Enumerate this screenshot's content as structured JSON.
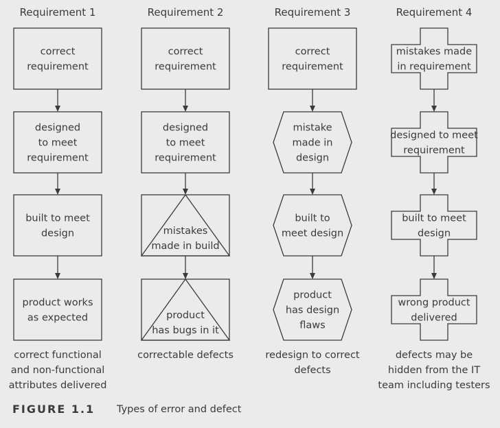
{
  "figure": {
    "label": "FIGURE 1.1",
    "caption": "Types of error and defect"
  },
  "columns": [
    {
      "title": "Requirement 1",
      "nodes": [
        {
          "shape": "rectangle",
          "lines": [
            "correct",
            "requirement"
          ]
        },
        {
          "shape": "rectangle",
          "lines": [
            "designed",
            "to meet",
            "requirement"
          ]
        },
        {
          "shape": "rectangle",
          "lines": [
            "built to meet",
            "design"
          ]
        },
        {
          "shape": "rectangle",
          "lines": [
            "product works",
            "as expected"
          ]
        }
      ],
      "outcome": [
        "correct functional",
        "and non-functional",
        "attributes delivered"
      ]
    },
    {
      "title": "Requirement 2",
      "nodes": [
        {
          "shape": "rectangle",
          "lines": [
            "correct",
            "requirement"
          ]
        },
        {
          "shape": "rectangle",
          "lines": [
            "designed",
            "to meet",
            "requirement"
          ]
        },
        {
          "shape": "triangle-in-rectangle",
          "lines": [
            "mistakes",
            "made in build"
          ]
        },
        {
          "shape": "triangle-in-rectangle",
          "lines": [
            "product",
            "has bugs in it"
          ]
        }
      ],
      "outcome": [
        "correctable defects"
      ]
    },
    {
      "title": "Requirement 3",
      "nodes": [
        {
          "shape": "rectangle",
          "lines": [
            "correct",
            "requirement"
          ]
        },
        {
          "shape": "hexagon",
          "lines": [
            "mistake",
            "made in",
            "design"
          ]
        },
        {
          "shape": "hexagon",
          "lines": [
            "built to",
            "meet design"
          ]
        },
        {
          "shape": "hexagon",
          "lines": [
            "product",
            "has design",
            "flaws"
          ]
        }
      ],
      "outcome": [
        "redesign to correct",
        "defects"
      ]
    },
    {
      "title": "Requirement 4",
      "nodes": [
        {
          "shape": "cross",
          "lines": [
            "mistakes made",
            "in requirement"
          ]
        },
        {
          "shape": "cross",
          "lines": [
            "designed to meet",
            "requirement"
          ]
        },
        {
          "shape": "cross",
          "lines": [
            "built to meet",
            "design"
          ]
        },
        {
          "shape": "cross",
          "lines": [
            "wrong product",
            "delivered"
          ]
        }
      ],
      "outcome": [
        "defects may be",
        "hidden from the IT",
        "team including testers"
      ]
    }
  ]
}
